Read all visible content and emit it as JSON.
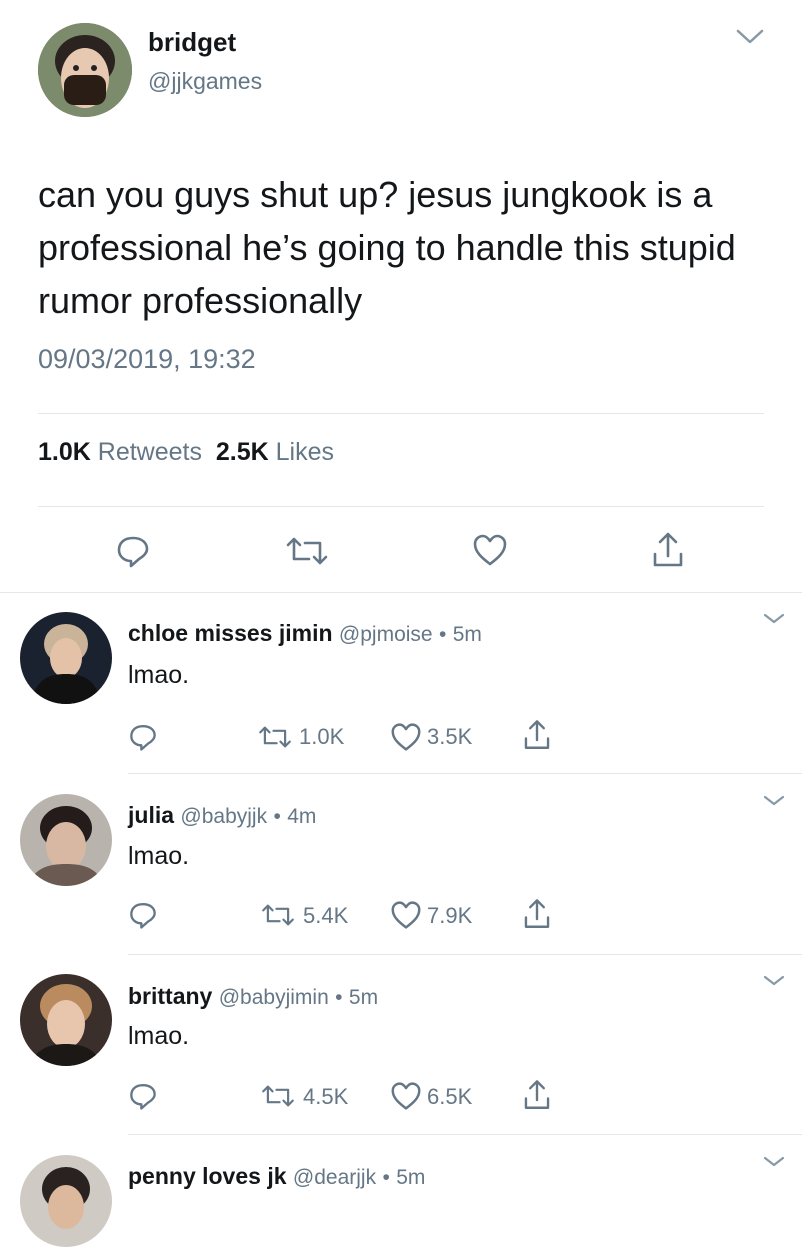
{
  "main_tweet": {
    "name": "bridget",
    "handle": "@jjkgames",
    "text": "can you guys shut up? jesus jungkook is a professional he’s going to handle this stupid rumor professionally",
    "timestamp": "09/03/2019, 19:32",
    "retweets_count": "1.0K",
    "retweets_label": "Retweets",
    "likes_count": "2.5K",
    "likes_label": "Likes"
  },
  "replies": [
    {
      "name": "chloe misses jimin",
      "handle": "@pjmoise",
      "dot": "•",
      "time": "5m",
      "text": "lmao.",
      "retweets": "1.0K",
      "likes": "3.5K"
    },
    {
      "name": "julia",
      "handle": "@babyjjk",
      "dot": "•",
      "time": "4m",
      "text": "lmao.",
      "retweets": "5.4K",
      "likes": "7.9K"
    },
    {
      "name": "brittany",
      "handle": "@babyjimin",
      "dot": "•",
      "time": "5m",
      "text": "lmao.",
      "retweets": "4.5K",
      "likes": "6.5K"
    },
    {
      "name": "penny loves jk",
      "handle": "@dearjjk",
      "dot": "•",
      "time": "5m"
    }
  ],
  "colors": {
    "text": "#14171a",
    "secondary": "#657786",
    "divider": "#e1e8ed",
    "icon": "#657786"
  }
}
